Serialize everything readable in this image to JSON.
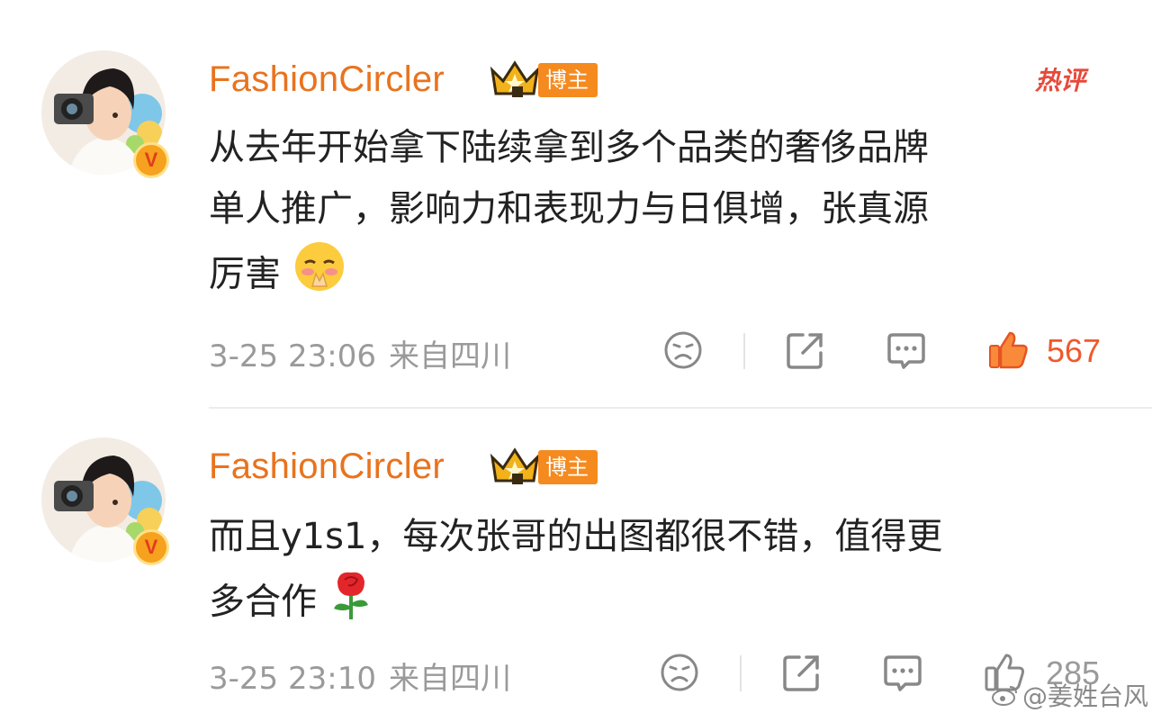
{
  "colors": {
    "accent": "#e8731e",
    "hot": "#e64a3b",
    "like_active": "#f0582b",
    "meta_gray": "#9a9a9a"
  },
  "comments": [
    {
      "username": "FashionCircler",
      "role_tag": "博主",
      "hot_tag": "热评",
      "text_lines": [
        "从去年开始拿下陆续拿到多个品类的奢侈品牌",
        "单人推广，影响力和表现力与日俱增，张真源",
        "厉害"
      ],
      "emoji": "pleading-face-emoji",
      "timestamp": "3-25 23:06",
      "location": "来自四川",
      "likes": "567",
      "liked": true
    },
    {
      "username": "FashionCircler",
      "role_tag": "博主",
      "text_lines": [
        "而且y1s1，每次张哥的出图都很不错，值得更",
        "多合作"
      ],
      "emoji": "rose-emoji",
      "timestamp": "3-25 23:10",
      "location": "来自四川",
      "likes": "285",
      "liked": false
    }
  ],
  "avatar_badge": "V",
  "watermark": "@姜姓台风",
  "icons": [
    "sad-face-icon",
    "share-icon",
    "comment-icon",
    "thumbs-up-icon",
    "crown-icon",
    "weibo-logo-icon"
  ]
}
